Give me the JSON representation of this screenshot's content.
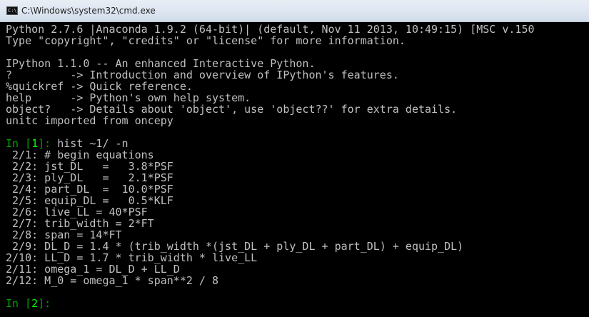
{
  "window": {
    "title": "C:\\Windows\\system32\\cmd.exe",
    "icon": "cmd-icon",
    "icon_glyph": "C:\\"
  },
  "console": {
    "banner": [
      "Python 2.7.6 |Anaconda 1.9.2 (64-bit)| (default, Nov 11 2013, 10:49:15) [MSC v.150",
      "Type \"copyright\", \"credits\" or \"license\" for more information.",
      "",
      "IPython 1.1.0 -- An enhanced Interactive Python.",
      "?         -> Introduction and overview of IPython's features.",
      "%quickref -> Quick reference.",
      "help      -> Python's own help system.",
      "object?   -> Details about 'object', use 'object??' for extra details.",
      "unitc imported from oncepy",
      ""
    ],
    "prompt1": {
      "prefix": "In [",
      "number": "1",
      "suffix": "]: ",
      "command": "hist ~1/ -n"
    },
    "history": [
      " 2/1: # begin equations",
      " 2/2: jst_DL   =   3.8*PSF",
      " 2/3: ply_DL   =   2.1*PSF",
      " 2/4: part_DL  =  10.0*PSF",
      " 2/5: equip_DL =   0.5*KLF",
      " 2/6: live_LL = 40*PSF",
      " 2/7: trib_width = 2*FT",
      " 2/8: span = 14*FT",
      " 2/9: DL_D = 1.4 * (trib_width *(jst_DL + ply_DL + part_DL) + equip_DL)",
      "2/10: LL_D = 1.7 * trib_width * live_LL",
      "2/11: omega_1 = DL_D + LL_D",
      "2/12: M_0 = omega_1 * span**2 / 8"
    ],
    "prompt2": {
      "prefix": "In [",
      "number": "2",
      "suffix": "]: ",
      "command": ""
    }
  }
}
